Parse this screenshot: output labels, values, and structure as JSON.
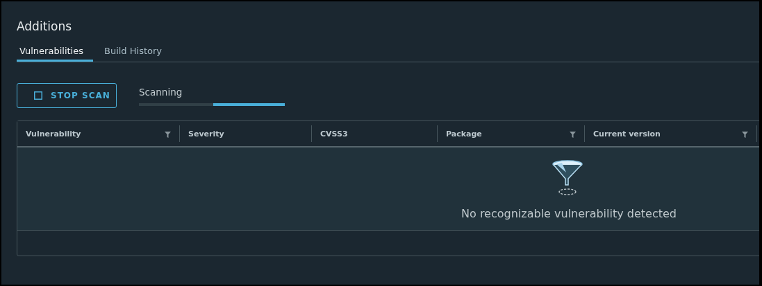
{
  "title": "Additions",
  "tabs": [
    {
      "label": "Vulnerabilities",
      "selected": true
    },
    {
      "label": "Build History",
      "selected": false
    }
  ],
  "stop_button": {
    "label": "STOP SCAN"
  },
  "scan_progress": {
    "label": "Scanning",
    "level": 0.49
  },
  "table": {
    "columns": [
      {
        "label": "Vulnerability",
        "filterable": true
      },
      {
        "label": "Severity",
        "filterable": false
      },
      {
        "label": "CVSS3",
        "filterable": false
      },
      {
        "label": "Package",
        "filterable": true
      },
      {
        "label": "Current version",
        "filterable": true
      }
    ],
    "empty_message": "No recognizable vulnerability detected"
  }
}
